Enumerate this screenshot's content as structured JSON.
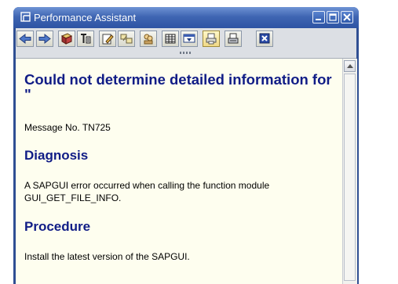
{
  "window": {
    "title": "Performance Assistant"
  },
  "toolbar": {
    "buttons": [
      {
        "name": "back-icon"
      },
      {
        "name": "forward-icon"
      },
      {
        "name": "book-icon"
      },
      {
        "name": "technical-info-icon"
      },
      {
        "name": "edit-icon"
      },
      {
        "name": "help-link-icon"
      },
      {
        "name": "people-icon"
      },
      {
        "name": "table-icon"
      },
      {
        "name": "window-options-icon"
      },
      {
        "name": "print-preview-icon"
      },
      {
        "name": "print-icon"
      },
      {
        "name": "close-x-icon"
      }
    ]
  },
  "content": {
    "heading": "Could not determine detailed information for \"",
    "message_no": "Message No. TN725",
    "diagnosis_title": "Diagnosis",
    "diagnosis_line1": "A SAPGUI error occurred when calling the function module",
    "diagnosis_line2": "GUI_GET_FILE_INFO.",
    "procedure_title": "Procedure",
    "procedure_text": "Install the latest version of the SAPGUI."
  }
}
